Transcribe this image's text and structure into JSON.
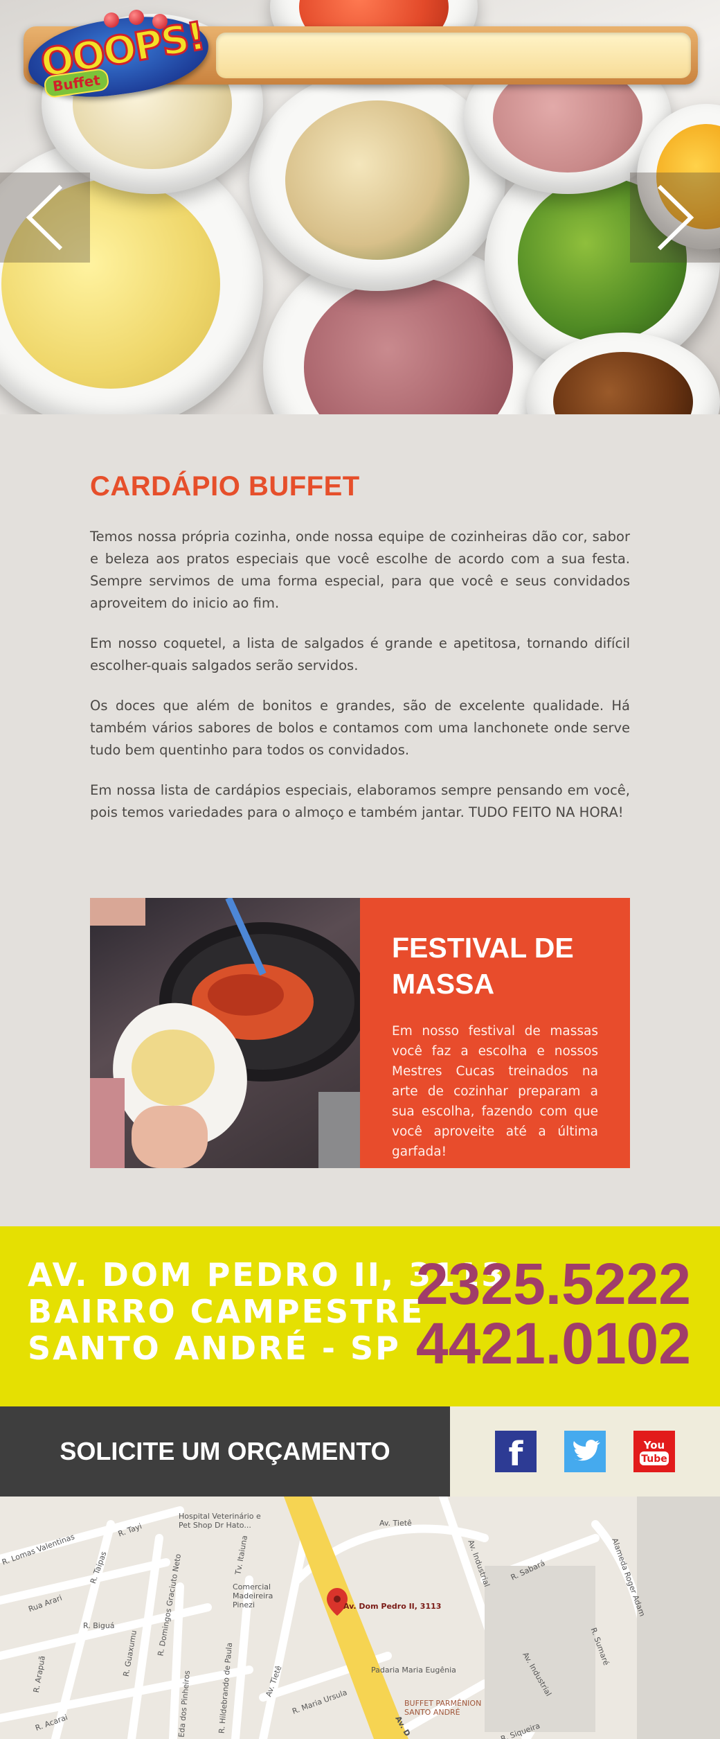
{
  "logo": {
    "brand": "OOOPS!",
    "sub": "Buffet"
  },
  "slider": {
    "prev_label": "‹",
    "next_label": "›"
  },
  "menu": {
    "title": "CARDÁPIO BUFFET",
    "paragraphs": [
      "Temos nossa própria cozinha, onde nossa equipe de cozinheiras dão cor, sabor e beleza aos pratos especiais que você escolhe de acordo com a sua festa. Sempre servimos de uma forma especial, para que você e seus convidados aproveitem do inicio ao fim.",
      "Em nosso coquetel, a lista de salgados é grande e apetitosa, tornando difícil escolher-quais salgados serão servidos.",
      "Os doces que além de bonitos e grandes, são de excelente qualidade. Há também vários sabores de bolos e contamos com uma lanchonete onde serve tudo bem quentinho para todos os convidados.",
      "Em nossa lista de cardápios especiais, elaboramos sempre pensando em você, pois temos variedades para o almoço e também jantar. TUDO FEITO NA HORA!"
    ]
  },
  "festival": {
    "title_line1": "FESTIVAL DE",
    "title_line2": "MASSA",
    "text": "Em nosso festival de massas você faz a escolha e nossos Mestres Cucas treinados na arte de cozinhar preparam a sua escolha, fazendo com que você aproveite até a última garfada!"
  },
  "contact": {
    "address_line1": "AV. DOM PEDRO II, 3113",
    "address_line2": "BAIRRO CAMPESTRE",
    "address_line3": "SANTO ANDRÉ - SP",
    "phone1": "2325.5222",
    "phone2": "4421.0102"
  },
  "quote": {
    "label": "SOLICITE UM ORÇAMENTO"
  },
  "social": {
    "facebook": "f",
    "youtube_top": "You",
    "youtube_bottom": "Tube"
  },
  "map": {
    "labels": {
      "hospital": "Hospital Veterinário e Pet Shop Dr Hato...",
      "comercial": "Comercial Madeireira Pinezi",
      "av_tiete": "Av. Tietê",
      "av_tiete2": "Av. Tietê",
      "av_industrial": "Av. Industrial",
      "av_industrial2": "Av. Industrial",
      "r_sabara": "R. Sabará",
      "r_sumare": "R. Sumaré",
      "alameda": "Alameda Roger Adam",
      "pin_label": "Av. Dom Pedro II, 3113",
      "padaria": "Padaria Maria Eugênia",
      "buffet_pin": "BUFFET PARMÊNION SANTO ANDRÉ",
      "lomas": "R. Lomas Valentinas",
      "tayi": "R. Tayi",
      "taipas": "R. Taipas",
      "arari": "Rua Arari",
      "bigua": "R. Biguá",
      "guaxumu": "R. Guaxumu",
      "graciuto": "R. Domingos Graciuto Neto",
      "itaiuna": "Tv. Itaiuna",
      "ursula": "R. Maria Ursula",
      "acarai": "R. Acarai",
      "arapua": "R. Arapuã",
      "pinheiros": "R. Eda dos Pinheiros",
      "hildebrando": "R. Hildebrando de Paula",
      "siqueira": "R. Siqueira",
      "dom_pedro_road": "Av. D"
    }
  },
  "colors": {
    "accent": "#e84c2c",
    "yellow_band": "#e5e002",
    "phone_text": "#a03d6a",
    "dark_bar": "#3e3e3e"
  }
}
